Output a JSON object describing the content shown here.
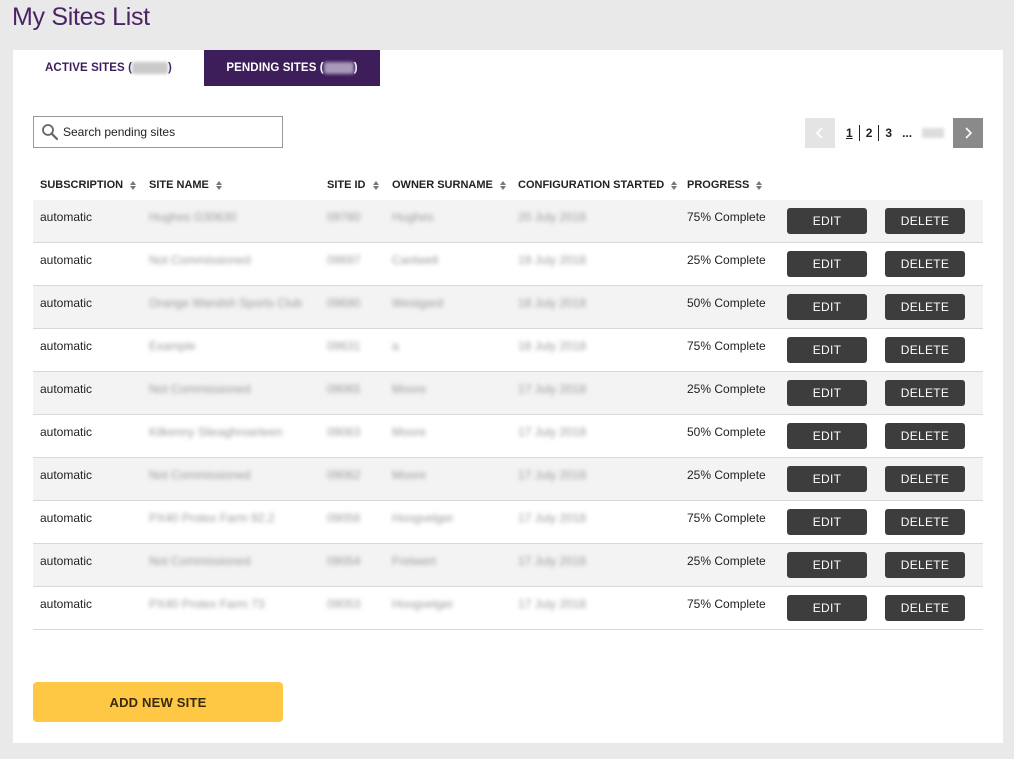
{
  "page": {
    "title": "My Sites List"
  },
  "tabs": {
    "active": {
      "label": "ACTIVE SITES (",
      "suffix": ")"
    },
    "pending": {
      "label": "PENDING SITES (",
      "suffix": ")"
    }
  },
  "search": {
    "placeholder": "Search pending sites",
    "value": ""
  },
  "pagination": {
    "pages": [
      "1",
      "2",
      "3"
    ],
    "current": "1",
    "ellipsis": "..."
  },
  "table": {
    "columns": [
      "SUBSCRIPTION",
      "SITE NAME",
      "SITE ID",
      "OWNER SURNAME",
      "CONFIGURATION STARTED",
      "PROGRESS"
    ],
    "rows": [
      {
        "subscription": "automatic",
        "site_name": "Hughes G30630",
        "site_id": "09780",
        "owner": "Hughes",
        "started": "20 July 2018",
        "progress": "75% Complete"
      },
      {
        "subscription": "automatic",
        "site_name": "Not Commissioned",
        "site_id": "09697",
        "owner": "Cantwell",
        "started": "19 July 2018",
        "progress": "25% Complete"
      },
      {
        "subscription": "automatic",
        "site_name": "Orange Wandsh Sports Club",
        "site_id": "09690",
        "owner": "Westgard",
        "started": "18 July 2018",
        "progress": "50% Complete"
      },
      {
        "subscription": "automatic",
        "site_name": "Example",
        "site_id": "09631",
        "owner": "a",
        "started": "18 July 2018",
        "progress": "75% Complete"
      },
      {
        "subscription": "automatic",
        "site_name": "Not Commissioned",
        "site_id": "09065",
        "owner": "Moore",
        "started": "17 July 2018",
        "progress": "25% Complete"
      },
      {
        "subscription": "automatic",
        "site_name": "Kilkenny Slieaghroarteen",
        "site_id": "09063",
        "owner": "Moore",
        "started": "17 July 2018",
        "progress": "50% Complete"
      },
      {
        "subscription": "automatic",
        "site_name": "Not Commissioned",
        "site_id": "09062",
        "owner": "Moore",
        "started": "17 July 2018",
        "progress": "25% Complete"
      },
      {
        "subscription": "automatic",
        "site_name": "PX40 Protex Farm 92.2",
        "site_id": "09056",
        "owner": "Hoogvelger",
        "started": "17 July 2018",
        "progress": "75% Complete"
      },
      {
        "subscription": "automatic",
        "site_name": "Not Commissioned",
        "site_id": "09054",
        "owner": "Fretwert",
        "started": "17 July 2018",
        "progress": "25% Complete"
      },
      {
        "subscription": "automatic",
        "site_name": "PX40 Protex Farm 73",
        "site_id": "09053",
        "owner": "Hoogvelger",
        "started": "17 July 2018",
        "progress": "75% Complete"
      }
    ],
    "edit_label": "EDIT",
    "delete_label": "DELETE"
  },
  "add_button": {
    "label": "ADD NEW SITE"
  },
  "colors": {
    "brand": "#3d1e5b",
    "accent": "#ffc844",
    "button": "#3d3d3d"
  }
}
